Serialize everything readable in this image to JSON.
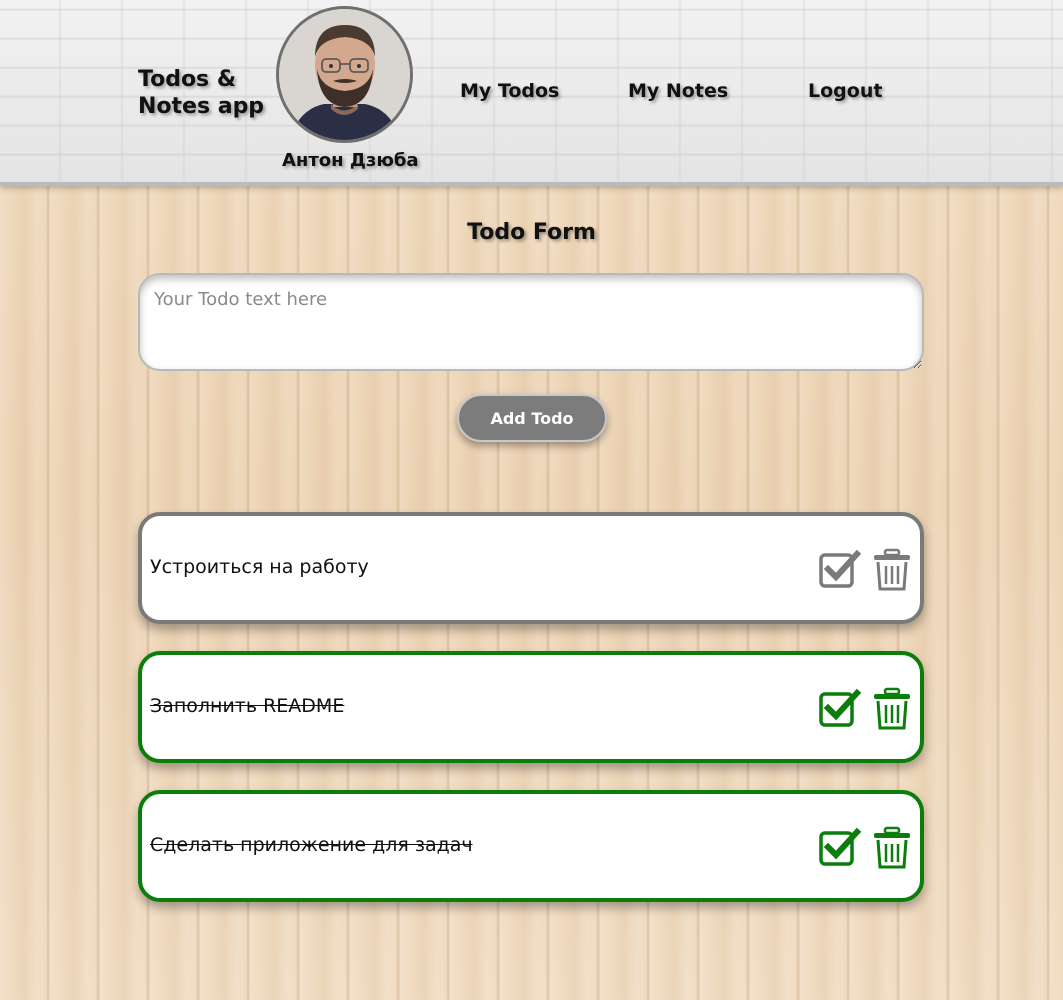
{
  "header": {
    "logo_line1": "Todos &",
    "logo_line2": "Notes app",
    "username": "Антон Дзюба",
    "nav": {
      "todos": "My Todos",
      "notes": "My Notes",
      "logout": "Logout"
    }
  },
  "form": {
    "title": "Todo Form",
    "placeholder": "Your Todo text here",
    "value": "",
    "submit_label": "Add Todo"
  },
  "todos": [
    {
      "text": "Устроиться на работу",
      "done": false
    },
    {
      "text": "Заполнить README",
      "done": true
    },
    {
      "text": "Сделать приложение для задач",
      "done": true
    }
  ],
  "colors": {
    "pending": "#7a7a7a",
    "done": "#0b7d0b",
    "button": "#7c7c7c"
  },
  "icons": {
    "complete": "checkbox-checked-icon",
    "delete": "trash-icon"
  }
}
